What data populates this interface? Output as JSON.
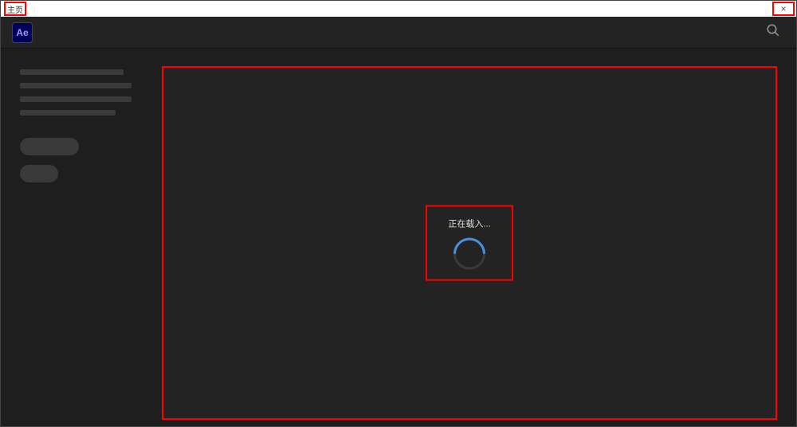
{
  "window": {
    "title": "主页",
    "close_label": "×"
  },
  "header": {
    "logo_text": "Ae"
  },
  "loading": {
    "text": "正在载入..."
  }
}
